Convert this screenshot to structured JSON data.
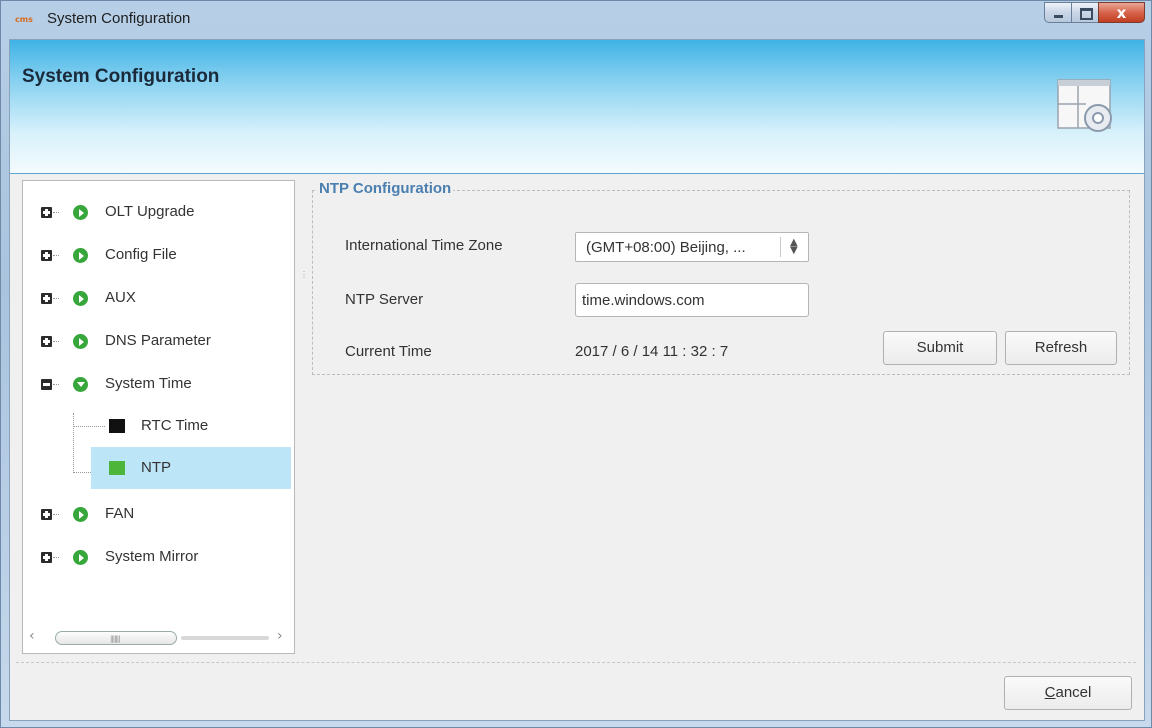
{
  "window": {
    "title": "System Configuration",
    "app_icon_text": "cms",
    "controls": {
      "minimize": "minimize",
      "maximize": "maximize",
      "close": "x"
    }
  },
  "banner": {
    "title": "System Configuration",
    "icon": "settings-window-icon"
  },
  "tree": {
    "items": [
      {
        "label": "OLT Upgrade",
        "expander": "plus"
      },
      {
        "label": "Config File",
        "expander": "plus"
      },
      {
        "label": "AUX",
        "expander": "plus"
      },
      {
        "label": "DNS Parameter",
        "expander": "plus"
      },
      {
        "label": "System Time",
        "expander": "minus",
        "children": [
          {
            "label": "RTC Time",
            "color": "#111111"
          },
          {
            "label": "NTP",
            "color": "#4db53a",
            "selected": true
          }
        ]
      },
      {
        "label": "FAN",
        "expander": "plus"
      },
      {
        "label": "System Mirror",
        "expander": "plus"
      }
    ]
  },
  "ntp": {
    "group_title": "NTP Configuration",
    "timezone_label": "International Time Zone",
    "timezone_value": "(GMT+08:00) Beijing, ...",
    "server_label": "NTP Server",
    "server_value": "time.windows.com",
    "current_time_label": "Current Time",
    "current_time_value": "2017 / 6 / 14  11 : 32 : 7",
    "submit_label": "Submit",
    "refresh_label": "Refresh"
  },
  "footer": {
    "cancel_label_u": "C",
    "cancel_label_rest": "ancel"
  },
  "colors": {
    "accent": "#4a7fb0",
    "selection": "#bde5f8",
    "node_green": "#37a73b"
  }
}
